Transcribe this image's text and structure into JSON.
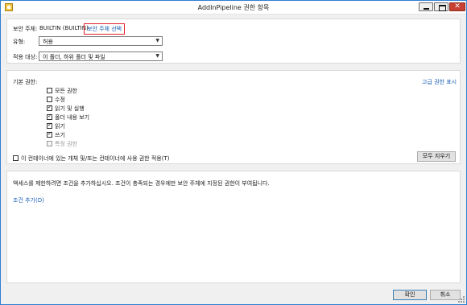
{
  "window": {
    "title": "AddInPipeline 권한 항목"
  },
  "principal": {
    "label": "보안 주체:",
    "value": "BUILTIN (BUILTIN)",
    "select_link": "보안 주체 선택"
  },
  "type": {
    "label": "유형:",
    "value": "허용"
  },
  "applies_to": {
    "label": "적용 대상:",
    "value": "이 폴더, 하위 폴더 및 파일"
  },
  "basic_permissions": {
    "label": "기본 권한:",
    "advanced_link": "고급 권한 표시",
    "items": [
      {
        "label": "모든 권한",
        "checked": false,
        "disabled": false
      },
      {
        "label": "수정",
        "checked": false,
        "disabled": false
      },
      {
        "label": "읽기 및 실행",
        "checked": true,
        "disabled": false
      },
      {
        "label": "폴더 내용 보기",
        "checked": true,
        "disabled": false
      },
      {
        "label": "읽기",
        "checked": true,
        "disabled": false
      },
      {
        "label": "쓰기",
        "checked": true,
        "disabled": false
      },
      {
        "label": "특정 권한",
        "checked": false,
        "disabled": true
      }
    ],
    "inherit_label": "이 컨테이너에 있는 개체 및/또는 컨테이너에 사용 권한 적용(T)",
    "clear_all": "모두 지우기"
  },
  "conditions": {
    "description": "액세스를 제한하려면 조건을 추가하십시오. 조건이 충족되는 경우에만 보안 주체에 지정된 권한이 부여됩니다.",
    "add_link": "조건 추가(D)"
  },
  "buttons": {
    "ok": "확인",
    "cancel": "취소"
  },
  "colors": {
    "accent_border": "#2d7fd0",
    "link": "#1a5fb4",
    "highlight_box": "#e0242c",
    "close_button": "#c84031"
  }
}
